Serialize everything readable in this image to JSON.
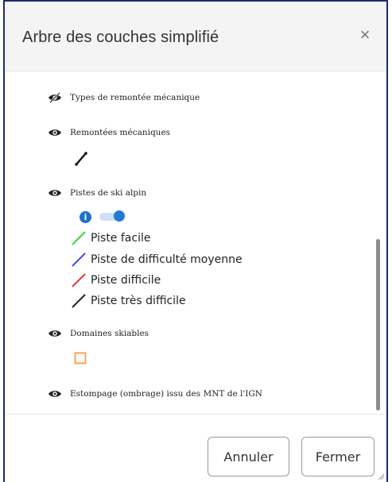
{
  "dialog": {
    "title": "Arbre des couches simplifié",
    "close_glyph": "×"
  },
  "layers": [
    {
      "label": "Types de remontée mécanique",
      "icon": "eye-slash-icon",
      "visible": false
    },
    {
      "label": "Remontées mécaniques",
      "icon": "eye-icon",
      "visible": true
    },
    {
      "label": "Pistes de ski alpin",
      "icon": "eye-icon",
      "visible": true
    },
    {
      "label": "Domaines skiables",
      "icon": "eye-icon",
      "visible": true
    },
    {
      "label": "Estompage (ombrage) issu des MNT de l'IGN",
      "icon": "eye-icon",
      "visible": true
    }
  ],
  "lift_legend": {
    "icon": "lift-line-icon",
    "color": "#111111"
  },
  "ski_legend": {
    "info_icon": "i",
    "toggle_on": true,
    "items": [
      {
        "label": "Piste facile",
        "color": "#3fcf3f"
      },
      {
        "label": "Piste de difficulté moyenne",
        "color": "#3f4fe0"
      },
      {
        "label": "Piste difficile",
        "color": "#e53a3a"
      },
      {
        "label": "Piste très difficile",
        "color": "#222222"
      }
    ]
  },
  "domain_legend": {
    "icon": "square-outline-icon",
    "color": "#f0a050"
  },
  "footer": {
    "cancel_label": "Annuler",
    "close_label": "Fermer"
  },
  "colors": {
    "accent": "#1f7ad8",
    "frame": "#1d2a6e"
  }
}
